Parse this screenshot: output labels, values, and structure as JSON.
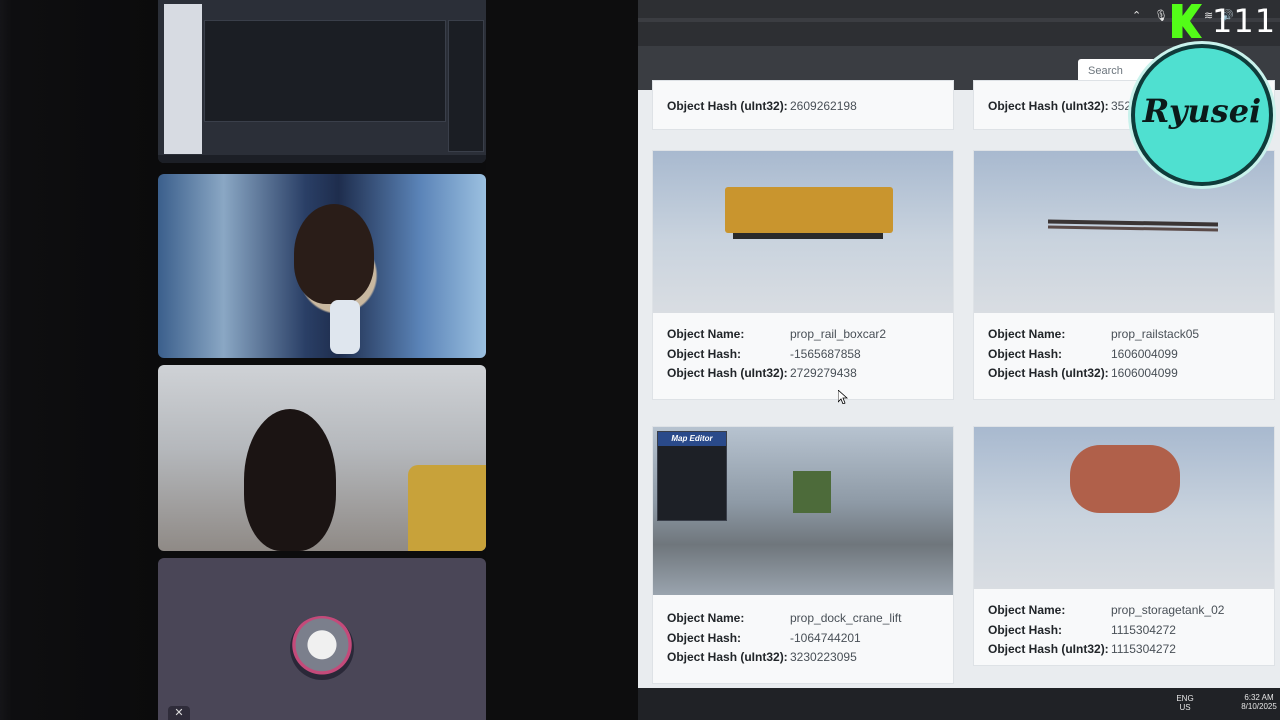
{
  "browser": {
    "search_placeholder": "Search"
  },
  "top_partial": [
    {
      "label": "Object Hash (uInt32):",
      "value": "2609262198"
    },
    {
      "label": "Object Hash (uInt32):",
      "value": "352"
    }
  ],
  "cards": [
    {
      "name_label": "Object Name:",
      "name": "prop_rail_boxcar2",
      "hash_label": "Object Hash:",
      "hash": "-1565687858",
      "uint_label": "Object Hash (uInt32):",
      "uint": "2729279438"
    },
    {
      "name_label": "Object Name:",
      "name": "prop_railstack05",
      "hash_label": "Object Hash:",
      "hash": "1606004099",
      "uint_label": "Object Hash (uInt32):",
      "uint": "1606004099"
    },
    {
      "name_label": "Object Name:",
      "name": "prop_dock_crane_lift",
      "hash_label": "Object Hash:",
      "hash": "-1064744201",
      "uint_label": "Object Hash (uInt32):",
      "uint": "3230223095"
    },
    {
      "name_label": "Object Name:",
      "name": "prop_storagetank_02",
      "hash_label": "Object Hash:",
      "hash": "1115304272",
      "uint_label": "Object Hash (uInt32):",
      "uint": "1115304272"
    }
  ],
  "map_editor_title": "Map Editor",
  "overlay": {
    "viewer_count": "111",
    "channel_logo_text": "Ryusei"
  },
  "taskbar": {
    "lang_top": "ENG",
    "lang_bottom": "US",
    "time": "6:32 AM",
    "date": "8/10/2025"
  }
}
